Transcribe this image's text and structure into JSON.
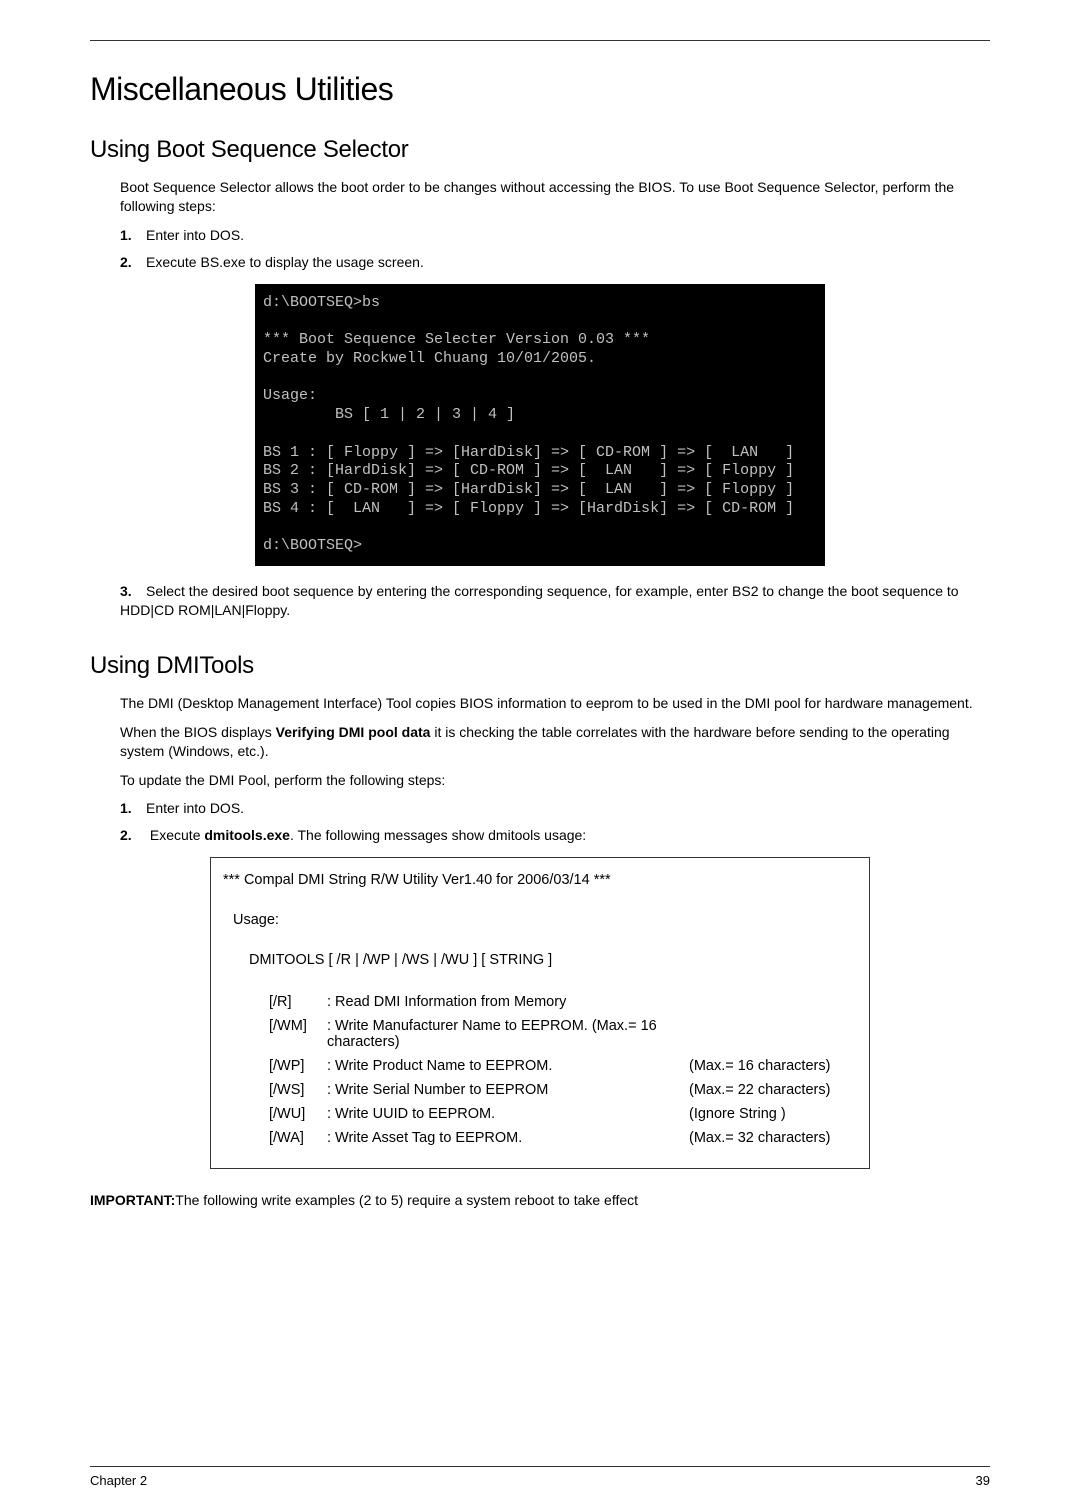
{
  "h1": "Miscellaneous Utilities",
  "section1": {
    "title": "Using Boot Sequence Selector",
    "intro": "Boot Sequence Selector allows the boot order to be changes without accessing the BIOS. To use Boot Sequence Selector, perform the following steps:",
    "step1": "Enter into DOS.",
    "step2": "Execute BS.exe to display the usage screen.",
    "terminal": "d:\\BOOTSEQ>bs\n\n*** Boot Sequence Selecter Version 0.03 ***\nCreate by Rockwell Chuang 10/01/2005.\n\nUsage:\n        BS [ 1 | 2 | 3 | 4 ]\n\nBS 1 : [ Floppy ] => [HardDisk] => [ CD-ROM ] => [  LAN   ]\nBS 2 : [HardDisk] => [ CD-ROM ] => [  LAN   ] => [ Floppy ]\nBS 3 : [ CD-ROM ] => [HardDisk] => [  LAN   ] => [ Floppy ]\nBS 4 : [  LAN   ] => [ Floppy ] => [HardDisk] => [ CD-ROM ]\n\nd:\\BOOTSEQ>",
    "step3": "Select the desired boot sequence by entering the corresponding sequence, for example, enter BS2 to change the boot sequence to HDD|CD ROM|LAN|Floppy."
  },
  "section2": {
    "title": "Using DMITools",
    "p1": "The DMI (Desktop Management Interface) Tool copies BIOS information to eeprom to be used in the DMI pool for hardware management.",
    "p2_pre": "When the BIOS displays ",
    "p2_bold": "Verifying DMI pool data",
    "p2_post": " it is checking the table correlates with the hardware before sending to the operating system (Windows, etc.).",
    "p3": "To update the DMI Pool, perform the following steps:",
    "step1": "Enter into DOS.",
    "step2_pre": "Execute ",
    "step2_bold": "dmitools.exe",
    "step2_post": ". The following messages show dmitools usage:",
    "usage": {
      "headline": "*** Compal DMI String R/W Utility Ver1.40 for 2006/03/14 ***",
      "usage_label": "Usage:",
      "cmd": "DMITOOLS [ /R | /WP | /WS | /WU ] [ STRING ]",
      "opts": [
        {
          "flag": "[/R]",
          "desc": ": Read DMI Information from Memory",
          "note": ""
        },
        {
          "flag": "[/WM]",
          "desc": ": Write Manufacturer Name to EEPROM. (Max.= 16 characters)",
          "note": ""
        },
        {
          "flag": "[/WP]",
          "desc": ": Write Product Name to EEPROM.",
          "note": "(Max.= 16 characters)"
        },
        {
          "flag": "[/WS]",
          "desc": ": Write Serial Number to EEPROM",
          "note": "(Max.= 22 characters)"
        },
        {
          "flag": "[/WU]",
          "desc": ": Write UUID to EEPROM.",
          "note": "(Ignore String          )"
        },
        {
          "flag": "[/WA]",
          "desc": ": Write Asset Tag to EEPROM.",
          "note": "(Max.= 32 characters)"
        }
      ]
    },
    "important_label": "IMPORTANT:",
    "important_text": "The following write examples (2 to 5) require a system reboot to take effect"
  },
  "footer": {
    "left": "Chapter 2",
    "right": "39"
  }
}
